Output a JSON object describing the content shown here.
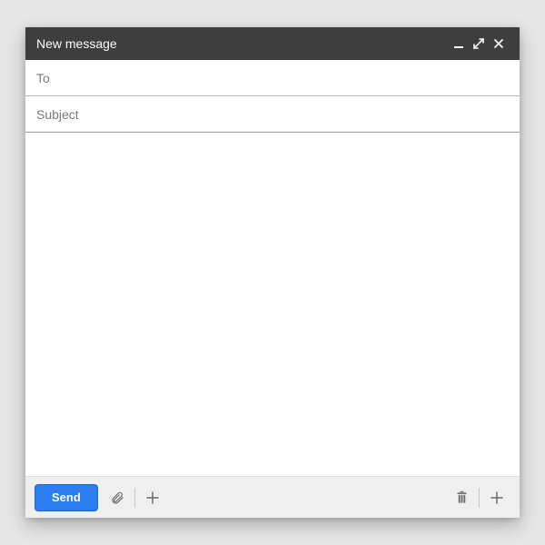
{
  "window": {
    "title": "New message"
  },
  "fields": {
    "to_label": "To",
    "subject_label": "Subject"
  },
  "toolbar": {
    "send_label": "Send"
  }
}
